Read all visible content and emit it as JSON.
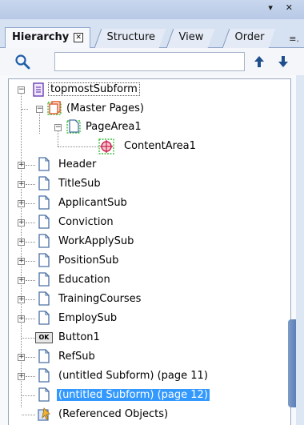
{
  "titlebar": {
    "controls": "▾ ✕"
  },
  "tabs": {
    "active": "Hierarchy",
    "active_close": "✕",
    "others": [
      "Structure",
      "View",
      "Order"
    ],
    "more": "≡."
  },
  "search": {
    "value": "",
    "placeholder": ""
  },
  "tree": {
    "root": "topmostSubform",
    "master_pages": "(Master Pages)",
    "page_area": "PageArea1",
    "content_area": "ContentArea1",
    "items": [
      "Header",
      "TitleSub",
      "ApplicantSub",
      "Conviction",
      "WorkApplySub",
      "PositionSub",
      "Education",
      "TrainingCourses",
      "EmploySub"
    ],
    "button": "Button1",
    "button_icon_text": "OK",
    "ref_sub": "RefSub",
    "untitled_11": "(untitled Subform) (page 11)",
    "untitled_12": "(untitled Subform) (page 12)",
    "referenced": "(Referenced Objects)"
  },
  "colors": {
    "selection": "#3399ff",
    "page_icon": "#4a6fa5",
    "master_icon": "#e0572b",
    "dashed_green": "#3fbf3f"
  }
}
